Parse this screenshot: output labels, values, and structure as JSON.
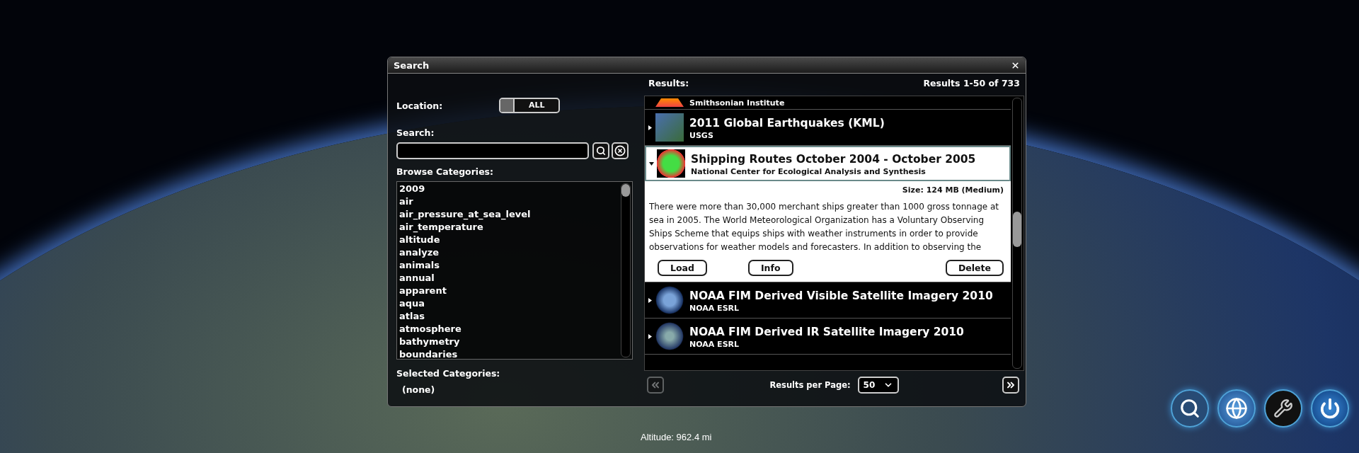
{
  "dialog": {
    "title": "Search"
  },
  "location": {
    "label": "Location:",
    "value": "ALL"
  },
  "search": {
    "label": "Search:"
  },
  "browse": {
    "label": "Browse Categories:",
    "items": [
      "2009",
      "air",
      "air_pressure_at_sea_level",
      "air_temperature",
      "altitude",
      "analyze",
      "animals",
      "annual",
      "apparent",
      "aqua",
      "atlas",
      "atmosphere",
      "bathymetry",
      "boundaries"
    ]
  },
  "selected_categories": {
    "label": "Selected Categories:",
    "value": "(none)"
  },
  "results": {
    "label": "Results:",
    "count": "Results 1-50 of 733",
    "items": [
      {
        "subtitle": "Smithsonian Institute",
        "expanded": false
      },
      {
        "title": "2011 Global Earthquakes (KML)",
        "subtitle": "USGS",
        "expanded": false
      },
      {
        "title": "Shipping Routes October 2004 - October 2005",
        "subtitle": "National Center for Ecological Analysis and Synthesis",
        "expanded": true,
        "size": "Size: 124 MB (Medium)",
        "description": "There were more than 30,000 merchant ships greater than 1000 gross tonnage at sea in 2005. The World Meteorological Organization has a Voluntary Observing Ships Scheme that equips ships with weather instruments in order to provide observations for weather models and forecasters. In addition to observing the",
        "buttons": [
          "Load",
          "Info",
          "Delete"
        ]
      },
      {
        "title": "NOAA FIM Derived Visible Satellite Imagery 2010",
        "subtitle": "NOAA ESRL",
        "expanded": false
      },
      {
        "title": "NOAA FIM Derived IR Satellite Imagery 2010",
        "subtitle": "NOAA ESRL",
        "expanded": false
      }
    ]
  },
  "pager": {
    "label": "Results per Page:",
    "per_page": "50",
    "previous": {
      "disabled": true
    },
    "next": {
      "disabled": false
    }
  },
  "altitude": "Altitude: 962.4 mi"
}
